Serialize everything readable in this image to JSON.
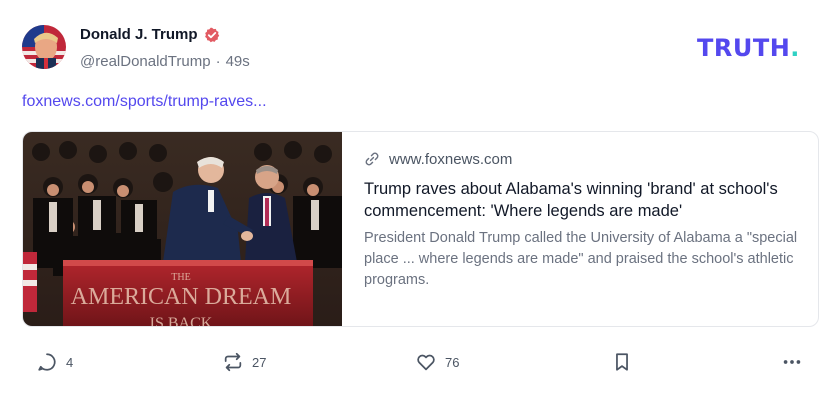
{
  "author": {
    "display_name": "Donald J. Trump",
    "handle": "@realDonaldTrump",
    "separator": "·",
    "timestamp": "49s",
    "verified": true
  },
  "brand": {
    "logo_text": "TRUTH",
    "logo_dot": ".",
    "accent": "#5448ee",
    "dot_color": "#2fd1c4"
  },
  "post": {
    "link_text": "foxnews.com/sports/trump-raves..."
  },
  "card": {
    "domain": "www.foxnews.com",
    "title": "Trump raves about Alabama's winning 'brand' at school's commencement: 'Where legends are made'",
    "description": "President Donald Trump called the University of Alabama a \"special place ... where legends are made\" and praised the school's athletic programs.",
    "image_caption_line1": "THE",
    "image_caption_line2": "AMERICAN DREAM",
    "image_caption_line3": "IS BACK"
  },
  "actions": {
    "reply_count": "4",
    "retruth_count": "27",
    "like_count": "76",
    "icons": [
      "reply-icon",
      "retruth-icon",
      "heart-icon",
      "bookmark-icon",
      "more-icon"
    ]
  }
}
